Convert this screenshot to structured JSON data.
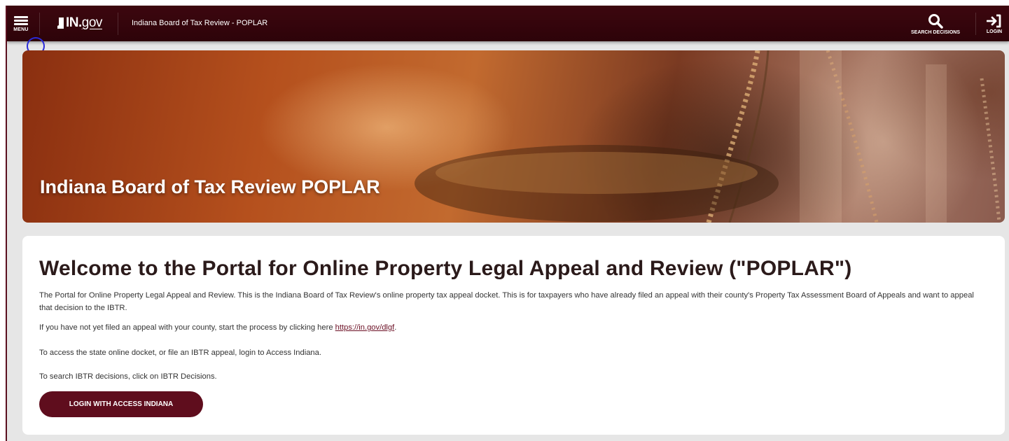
{
  "header": {
    "menu_label": "MENU",
    "ingov_prefix": "IN.",
    "ingov_suffix": "gov",
    "site_title": "Indiana Board of Tax Review - POPLAR",
    "search_label": "SEARCH DECISIONS",
    "login_label": "LOGIN"
  },
  "hero": {
    "title": "Indiana Board of Tax Review POPLAR"
  },
  "content": {
    "heading": "Welcome to the Portal for Online Property Legal Appeal and Review (\"POPLAR\")",
    "para1": "The Portal for Online Property Legal Appeal and Review. This is the Indiana Board of Tax Review's online property tax appeal docket. This is for taxpayers who have already filed an appeal with their county's Property Tax Assessment Board of Appeals and want to appeal that decision to the IBTR.",
    "para2_prefix": "If you have not yet filed an appeal with your county, start the process by clicking here ",
    "para2_link": "https://in.gov/dlgf",
    "para2_suffix": ".",
    "para3": "To access the state online docket, or file an IBTR appeal, login to Access Indiana.",
    "para4": "To search IBTR decisions, click on IBTR Decisions.",
    "login_button": "LOGIN WITH ACCESS INDIANA"
  },
  "colors": {
    "header_bg": "#2d0309",
    "brand_maroon": "#5f0d1d",
    "link": "#6b0f24"
  },
  "icons": [
    "menu-icon",
    "in-gov-logo",
    "search-icon",
    "login-icon"
  ]
}
